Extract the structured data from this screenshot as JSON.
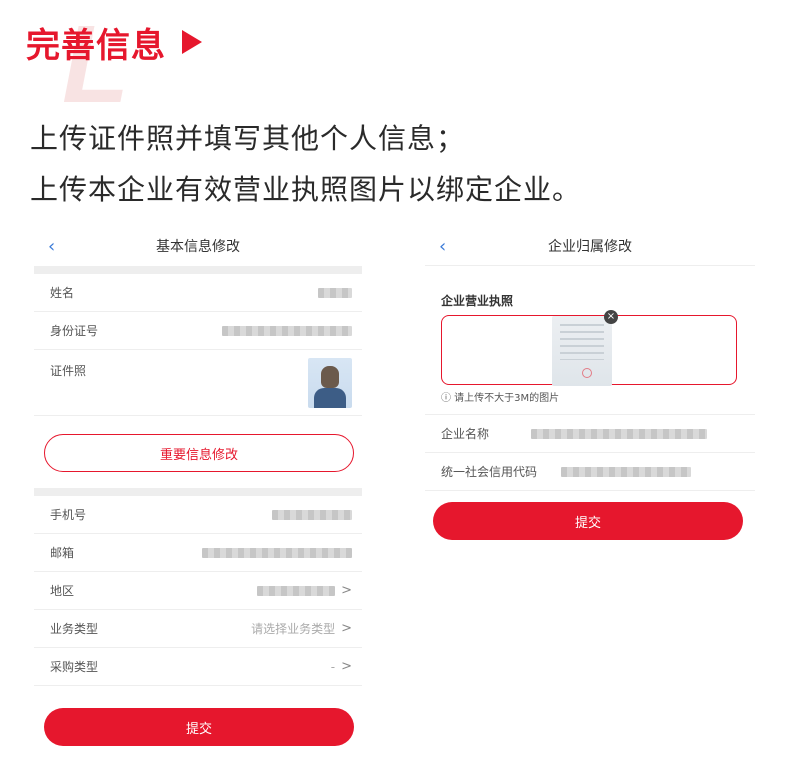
{
  "hero": {
    "title": "完善信息",
    "line1": "上传证件照并填写其他个人信息；",
    "line2": "上传本企业有效营业执照图片以绑定企业。"
  },
  "left_screen": {
    "back": "‹",
    "title": "基本信息修改",
    "rows_top": [
      {
        "label": "姓名"
      },
      {
        "label": "身份证号"
      }
    ],
    "photo_label": "证件照",
    "important_button": "重要信息修改",
    "rows_bottom": [
      {
        "label": "手机号"
      },
      {
        "label": "邮箱"
      },
      {
        "label": "地区",
        "chevron": ">"
      },
      {
        "label": "业务类型",
        "value": "请选择业务类型",
        "chevron": ">"
      },
      {
        "label": "采购类型",
        "value": "-",
        "chevron": ">"
      }
    ],
    "submit": "提交"
  },
  "right_screen": {
    "back": "‹",
    "title": "企业归属修改",
    "section_title": "企业营业执照",
    "close": "×",
    "hint": "ⓘ 请上传不大于3M的图片",
    "rows": [
      {
        "label": "企业名称"
      },
      {
        "label": "统一社会信用代码"
      }
    ],
    "submit": "提交"
  },
  "colors": {
    "accent": "#e6172d",
    "divider": "#eeeeee",
    "back_arrow": "#3b7bd8"
  }
}
